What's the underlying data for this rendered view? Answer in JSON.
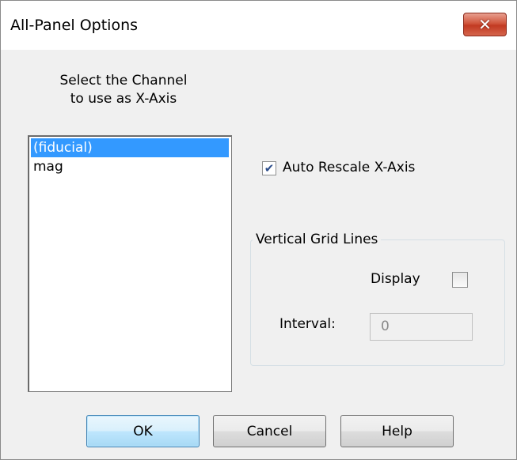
{
  "window": {
    "title": "All-Panel Options",
    "close_icon": "close-icon"
  },
  "channel_select": {
    "label_line1": "Select the Channel",
    "label_line2": "to use as X-Axis",
    "items": [
      {
        "label": "(fiducial)",
        "selected": true
      },
      {
        "label": "mag",
        "selected": false
      }
    ]
  },
  "auto_rescale": {
    "label": "Auto Rescale X-Axis",
    "checked": true
  },
  "grid_group": {
    "title": "Vertical Grid Lines",
    "display_label": "Display",
    "display_checked": false,
    "interval_label": "Interval:",
    "interval_value": "0"
  },
  "buttons": {
    "ok": "OK",
    "cancel": "Cancel",
    "help": "Help"
  },
  "colors": {
    "selection": "#3399ff",
    "close_button": "#c23a22"
  }
}
